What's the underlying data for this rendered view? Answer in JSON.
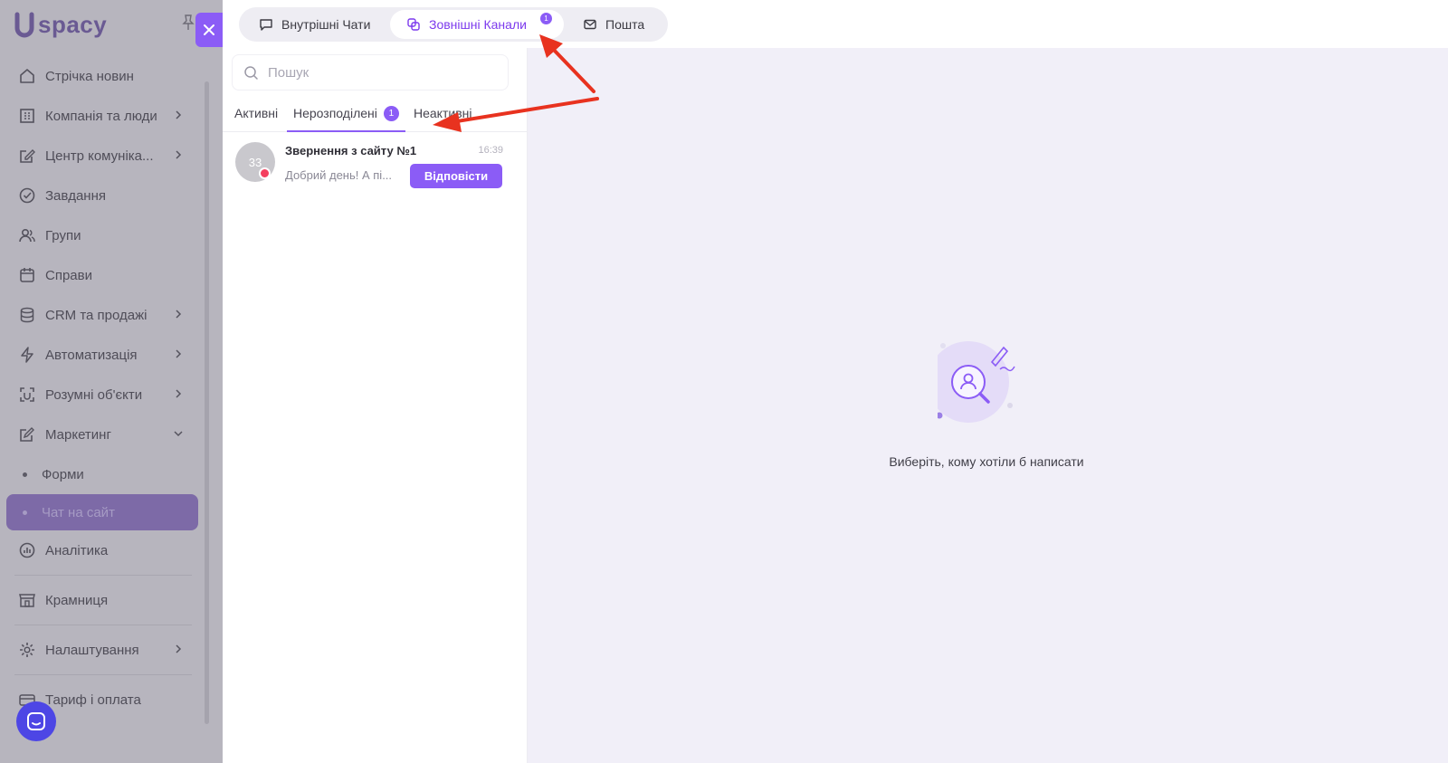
{
  "app": {
    "logo_text": "spacy"
  },
  "sidebar": {
    "items": [
      {
        "label": "Стрічка новин",
        "icon": "home-icon"
      },
      {
        "label": "Компанія та люди",
        "icon": "building-icon"
      },
      {
        "label": "Центр комуніка...",
        "icon": "pencil-square-icon"
      },
      {
        "label": "Завдання",
        "icon": "check-circle-icon"
      },
      {
        "label": "Групи",
        "icon": "users-icon"
      },
      {
        "label": "Справи",
        "icon": "calendar-icon"
      },
      {
        "label": "CRM та продажі",
        "icon": "database-icon"
      },
      {
        "label": "Автоматизація",
        "icon": "bolt-icon"
      },
      {
        "label": "Розумні об'єкти",
        "icon": "scan-icon"
      },
      {
        "label": "Маркетинг",
        "icon": "edit-icon"
      }
    ],
    "marketing_sub": [
      {
        "label": "Форми"
      },
      {
        "label": "Чат на сайт"
      }
    ],
    "bottom_items": [
      {
        "label": "Аналітика",
        "icon": "chart-icon"
      },
      {
        "label": "Крамниця",
        "icon": "store-icon"
      },
      {
        "label": "Налаштування",
        "icon": "gear-icon"
      },
      {
        "label": "Тариф і оплата",
        "icon": "card-icon"
      }
    ]
  },
  "top_tabs": [
    {
      "label": "Внутрішні Чати",
      "icon": "chat-bubble-icon"
    },
    {
      "label": "Зовнішні Канали",
      "icon": "channels-icon",
      "badge": "1"
    },
    {
      "label": "Пошта",
      "icon": "mail-icon"
    }
  ],
  "search": {
    "placeholder": "Пошук"
  },
  "sub_tabs": [
    {
      "label": "Активні"
    },
    {
      "label": "Нерозподілені",
      "badge": "1"
    },
    {
      "label": "Неактивні"
    }
  ],
  "chat": {
    "avatar_text": "33",
    "title": "Звернення з сайту №1",
    "time": "16:39",
    "preview": "Добрий день! А пі...",
    "reply_label": "Відповісти"
  },
  "empty_state": {
    "text": "Виберіть, кому хотіли б написати"
  },
  "colors": {
    "accent": "#8b5cf6",
    "annotation": "#e8321f",
    "sidebar_dim": "#b7b5be",
    "content_bg": "#f1eff8"
  }
}
